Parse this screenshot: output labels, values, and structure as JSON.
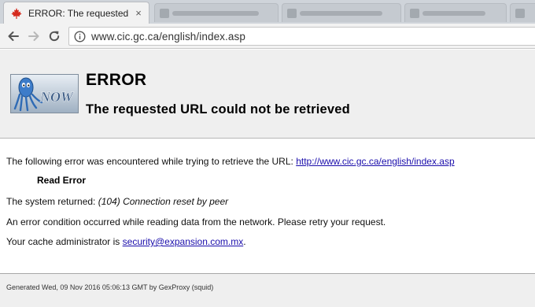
{
  "browser": {
    "active_tab": {
      "title": "ERROR: The requested U",
      "close_label": "×",
      "favicon": "maple-leaf-icon"
    },
    "toolbar": {
      "back_icon": "arrow-left-icon",
      "forward_icon": "arrow-right-icon",
      "reload_icon": "reload-icon",
      "info_icon": "info-circle-icon",
      "url": "www.cic.gc.ca/english/index.asp"
    }
  },
  "page": {
    "logo": {
      "text": "NOW",
      "icon": "squid-logo-icon"
    },
    "title": "ERROR",
    "subtitle": "The requested URL could not be retrieved",
    "intro_text": "The following error was encountered while trying to retrieve the URL: ",
    "intro_link": "http://www.cic.gc.ca/english/index.asp",
    "error_name": "Read Error",
    "system_returned_label": "The system returned: ",
    "system_returned_value": "(104) Connection reset by peer",
    "explanation": "An error condition occurred while reading data from the network. Please retry your request.",
    "admin_text": "Your cache administrator is ",
    "admin_email": "security@expansion.com.mx",
    "admin_suffix": ".",
    "footer": "Generated Wed, 09 Nov 2016 05:06:13 GMT by GexProxy (squid)"
  },
  "colors": {
    "link": "#1a0dab",
    "favicon_red": "#d52b1e",
    "header_bg": "#efefef"
  }
}
